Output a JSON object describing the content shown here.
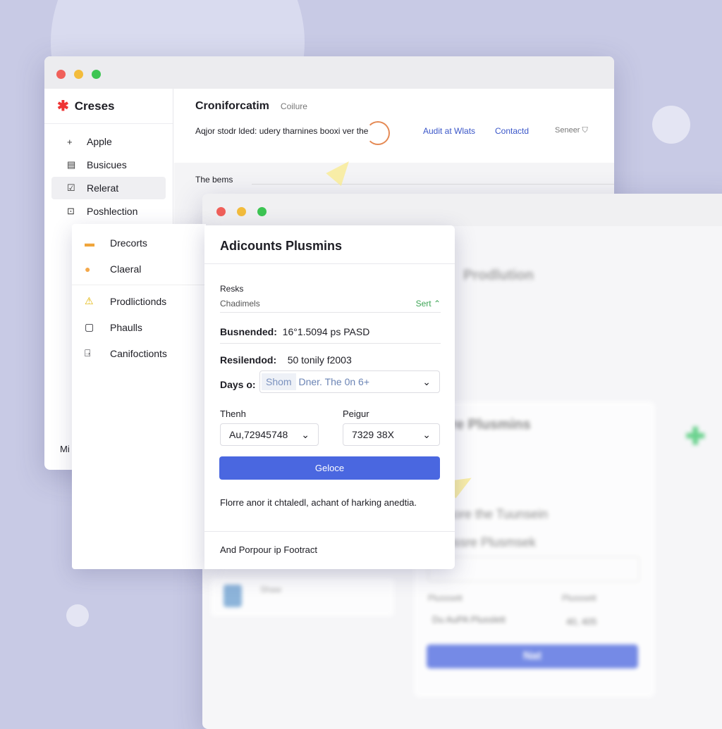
{
  "back_window": {
    "brand": "Creses",
    "sidebar": [
      {
        "icon": "plus-icon",
        "glyph": "+",
        "label": "Apple"
      },
      {
        "icon": "document-icon",
        "glyph": "▤",
        "label": "Busicues"
      },
      {
        "icon": "checkbox-icon",
        "glyph": "☑",
        "label": "Relerat"
      },
      {
        "icon": "inbox-icon",
        "glyph": "⊡",
        "label": "Poshlection"
      }
    ],
    "sidebar_footer": "Mi",
    "title": "Croniforcatim",
    "subtitle": "Coilure",
    "description": "Aqjor stodr lded: udery tharnines booxi ver the",
    "links": [
      "Audit at Wlats",
      "Contactd"
    ],
    "secondary": "Seneer",
    "section": "The bems"
  },
  "menu": {
    "items": [
      {
        "icon": "folder-icon",
        "glyph": "▬",
        "label": "Drecorts"
      },
      {
        "icon": "user-icon",
        "glyph": "●",
        "label": "Claeral"
      },
      {
        "icon": "warning-icon",
        "glyph": "⚠",
        "label": "Prodlictionds"
      },
      {
        "icon": "page-icon",
        "glyph": "▢",
        "label": "Phaulls"
      },
      {
        "icon": "file-icon",
        "glyph": "⍈",
        "label": "Canifoctionts"
      }
    ]
  },
  "dialog": {
    "title": "Adicounts Plusmins",
    "label1": "Resks",
    "label2": "Chadimels",
    "sort": "Sert",
    "f1_label": "Busnended:",
    "f1_value": "16°1.5094 ps PASD",
    "f2_label": "Resilendod:",
    "f2_value": "50 tonily f2003",
    "f3_label": "Days o:",
    "f3_tag": "Shom",
    "f3_value": "Dner. The 0n 6+",
    "col1_label": "Thenh",
    "col1_value": "Au,72945748",
    "col2_label": "Peigur",
    "col2_value": "7329 38X",
    "button": "Geloce",
    "note": "Florre anor it chtaledl, achant of harking anedtia.",
    "footer": "And Porpour ip Footract",
    "accent": "#4a67e0"
  },
  "bg_window": {
    "title": "Prodlution",
    "panel_title": "ore Plusmins",
    "line1": "Ulsore the Tuunsein",
    "line2": "Plussre Plusmsek",
    "label_a": "Plusssett",
    "label_b": "Plusssett",
    "value_a": "Du AuPA Plusslett",
    "value_b": "40, 405",
    "button": "Nat",
    "card": "Shaw"
  }
}
